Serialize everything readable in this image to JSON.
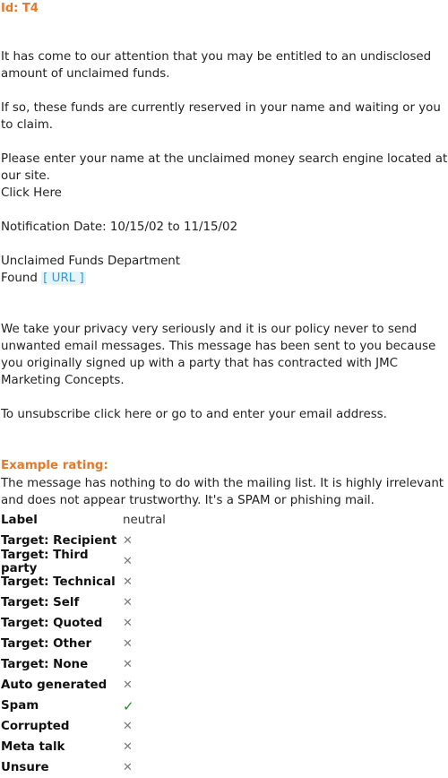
{
  "id_line": "Id: T4",
  "message": {
    "p1": "It has come to our attention that you may be entitled to an undisclosed amount of unclaimed funds.",
    "p2": "If so, these funds are currently reserved in your name and waiting or you to claim.",
    "p3": "Please enter your name at the unclaimed money search engine located at our site.",
    "click_here": "Click Here",
    "notification": "Notification Date: 10/15/02 to 11/15/02",
    "dept": "Unclaimed Funds Department",
    "found_prefix": "Found",
    "url_chip": "[ URL ]",
    "p_privacy": "We take your privacy very seriously and it is our policy never to send unwanted email messages. This message has been sent to you because you originally signed up with a party that has contracted with JMC Marketing Concepts.",
    "p_unsub": "To unsubscribe click here or go to and enter your email address."
  },
  "rating": {
    "title": "Example rating:",
    "text": "The message has nothing to do with the mailing list. It is highly irrelevant and does not appear trustworthy. It's a SPAM or phishing mail.",
    "label_key": "Label",
    "label_value": "neutral",
    "rows": [
      {
        "key": "Target: Recipient",
        "mark": "✕"
      },
      {
        "key": "Target: Third party",
        "mark": "✕"
      },
      {
        "key": "Target: Technical",
        "mark": "✕"
      },
      {
        "key": "Target: Self",
        "mark": "✕"
      },
      {
        "key": "Target: Quoted",
        "mark": "✕"
      },
      {
        "key": "Target: Other",
        "mark": "✕"
      },
      {
        "key": "Target: None",
        "mark": "✕"
      },
      {
        "key": "Auto generated",
        "mark": "✕"
      },
      {
        "key": "Spam",
        "mark": "✓"
      },
      {
        "key": "Corrupted",
        "mark": "✕"
      },
      {
        "key": "Meta talk",
        "mark": "✕"
      },
      {
        "key": "Unsure",
        "mark": "✕"
      }
    ]
  },
  "colors": {
    "accent": "#e07a2e",
    "link": "#2a9fd6",
    "check": "#2e8b2e"
  }
}
